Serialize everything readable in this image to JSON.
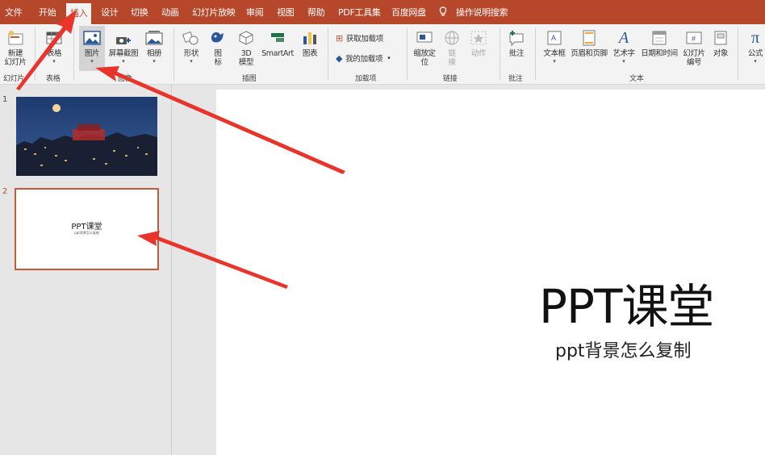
{
  "menubar": {
    "tabs": [
      "文件",
      "开始",
      "插入",
      "设计",
      "切换",
      "动画",
      "幻灯片放映",
      "审阅",
      "视图",
      "帮助",
      "PDF工具集",
      "百度网盘"
    ],
    "active_tab": "插入",
    "tell_me": "操作说明搜索"
  },
  "ribbon": {
    "slides": {
      "new_slide": "新建\n幻灯片",
      "group": "幻灯片"
    },
    "tables": {
      "table": "表格",
      "group": "表格"
    },
    "images": {
      "pictures": "图片",
      "screenshot": "屏幕截图",
      "album": "相册",
      "group": "图像"
    },
    "illustrations": {
      "shapes": "形状",
      "icons": "图\n标",
      "model3d": "3D\n模型",
      "smartart": "SmartArt",
      "chart": "图表",
      "group": "插图"
    },
    "addins": {
      "get": "获取加载项",
      "mine": "我的加载项",
      "group": "加载项"
    },
    "links": {
      "zoom": "缩放定\n位",
      "link": "链\n接",
      "action": "动作",
      "group": "链接"
    },
    "comments": {
      "comment": "批注",
      "group": "批注"
    },
    "text": {
      "textbox": "文本框",
      "header_footer": "页眉和页脚",
      "wordart": "艺术字",
      "datetime": "日期和时间",
      "slide_number": "幻灯片\n编号",
      "object": "对象",
      "group": "文本"
    },
    "symbols": {
      "equation": "公式"
    }
  },
  "thumbnails": [
    {
      "number": "1"
    },
    {
      "number": "2",
      "title": "PPT课堂",
      "subtitle": "ppt背景怎么复制",
      "selected": true
    }
  ],
  "slide": {
    "title": "PPT课堂",
    "subtitle": "ppt背景怎么复制"
  },
  "colors": {
    "accent": "#b7472a",
    "annotation": "#e8342a"
  }
}
